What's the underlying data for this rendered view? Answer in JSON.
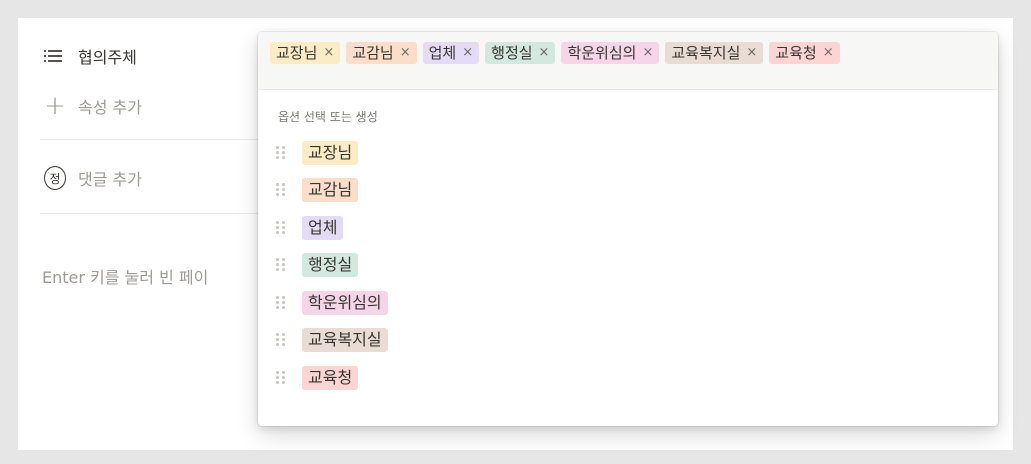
{
  "sidebar": {
    "property_name": "협의주체",
    "add_property": "속성 추가",
    "add_comment": "댓글 추가",
    "avatar_initial": "정",
    "hint": "Enter 키를 눌러 빈 페이"
  },
  "selected_tags": [
    {
      "label": "교장님",
      "color": "#fbecc6"
    },
    {
      "label": "교감님",
      "color": "#fadec9"
    },
    {
      "label": "업체",
      "color": "#e4dcf4"
    },
    {
      "label": "행정실",
      "color": "#d3e8df"
    },
    {
      "label": "학운위심의",
      "color": "#f5d6e8"
    },
    {
      "label": "교육복지실",
      "color": "#e9dcd4"
    },
    {
      "label": "교육청",
      "color": "#fbd4d4"
    }
  ],
  "remove_glyph": "×",
  "dropdown": {
    "label": "옵션 선택 또는 생성",
    "options": [
      {
        "label": "교장님",
        "color": "#fbecc6"
      },
      {
        "label": "교감님",
        "color": "#fadec9"
      },
      {
        "label": "업체",
        "color": "#e4dcf4"
      },
      {
        "label": "행정실",
        "color": "#d3e8df"
      },
      {
        "label": "학운위심의",
        "color": "#f5d6e8"
      },
      {
        "label": "교육복지실",
        "color": "#e9dcd4"
      },
      {
        "label": "교육청",
        "color": "#fbd4d4"
      }
    ]
  }
}
